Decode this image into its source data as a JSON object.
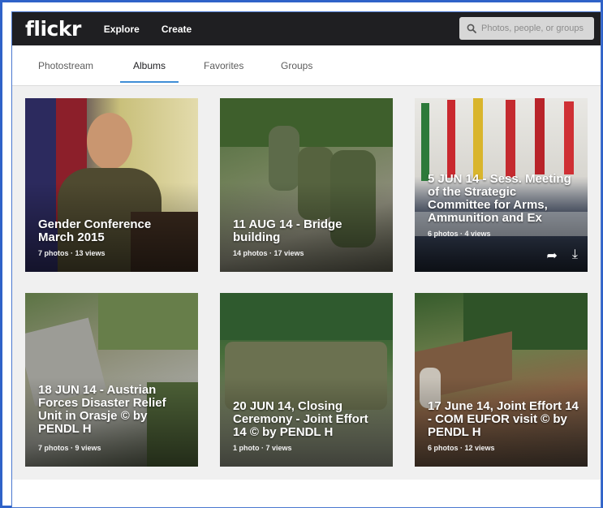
{
  "header": {
    "logo": "flickr",
    "nav": [
      "Explore",
      "Create"
    ],
    "search_placeholder": "Photos, people, or groups"
  },
  "tabs": [
    {
      "label": "Photostream",
      "active": false
    },
    {
      "label": "Albums",
      "active": true
    },
    {
      "label": "Favorites",
      "active": false
    },
    {
      "label": "Groups",
      "active": false
    }
  ],
  "albums": [
    {
      "title": "Gender Conference March 2015",
      "meta": "7 photos  ·  13 views"
    },
    {
      "title": "11 AUG 14 - Bridge building",
      "meta": "14 photos  ·  17 views"
    },
    {
      "title": "5 JUN 14 - Sess. Meeting of the Strategic Committee for Arms, Ammunition and Ex",
      "meta": "6 photos  ·  4 views"
    },
    {
      "title": "18 JUN 14 - Austrian Forces Disaster Relief Unit in Orasje © by PENDL H",
      "meta": "7 photos  ·  9 views"
    },
    {
      "title": "20 JUN 14, Closing Ceremony - Joint Effort 14 © by PENDL H",
      "meta": "1 photo  ·  7 views"
    },
    {
      "title": "17 June 14, Joint Effort 14 - COM EUFOR visit © by PENDL H",
      "meta": "6 photos  ·  12 views"
    }
  ],
  "colors": {
    "topbar": "#1f1f22",
    "accent_underline": "#3f8ed6",
    "frame_border": "#2f62c8"
  },
  "icons": [
    "search-icon",
    "share-icon",
    "download-icon"
  ]
}
